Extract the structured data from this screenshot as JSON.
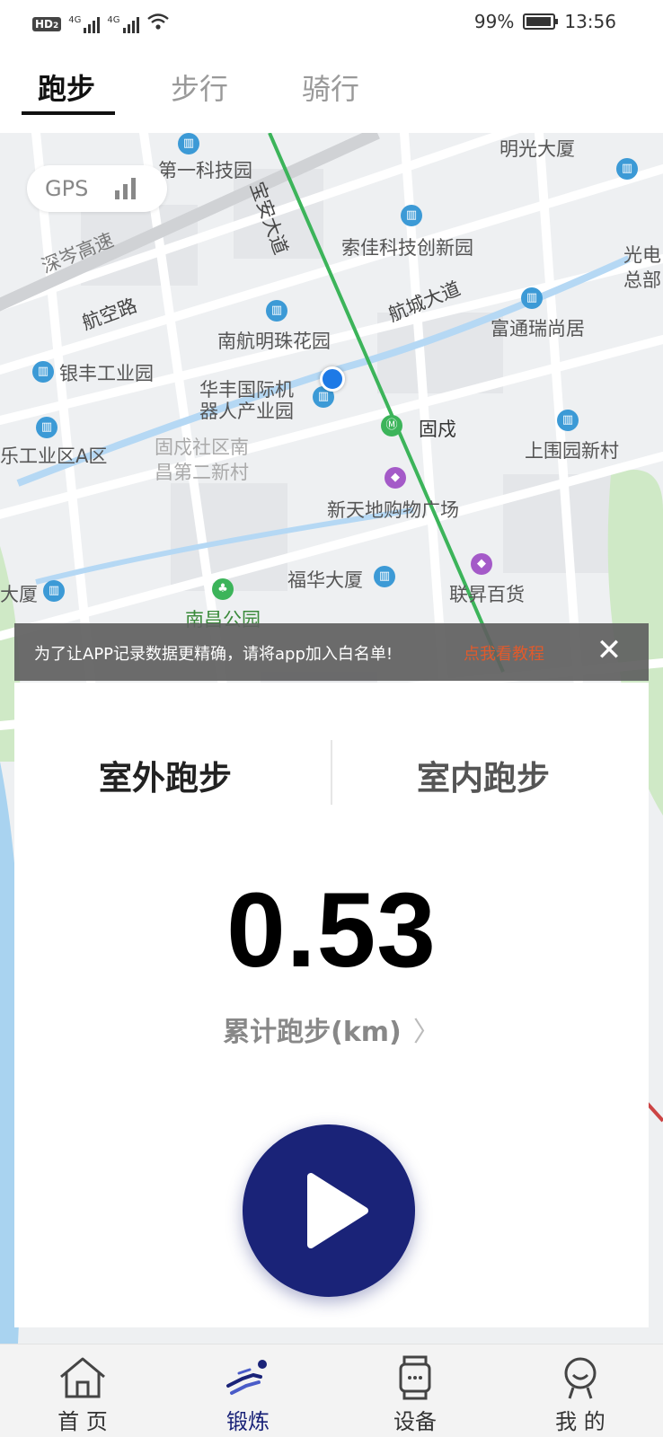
{
  "status_bar": {
    "network_left": "HD",
    "network_sub": "2",
    "signal_1": "4G",
    "signal_2": "4G",
    "battery": "99%",
    "time": "13:56"
  },
  "tabs": [
    {
      "label": "跑步",
      "active": true
    },
    {
      "label": "步行",
      "active": false
    },
    {
      "label": "骑行",
      "active": false
    }
  ],
  "map": {
    "gps_label": "GPS",
    "labels": [
      "第一科技园",
      "明光大厦",
      "宝安大道",
      "深岑高速",
      "索佳科技创新园",
      "光电",
      "总部",
      "航空路",
      "航城大道",
      "南航明珠花园",
      "富通瑞尚居",
      "银丰工业园",
      "华丰国际机",
      "器人产业园",
      "固戍",
      "乐工业区A区",
      "固戍社区南",
      "昌第二新村",
      "上围园新村",
      "新天地购物广场",
      "福华大厦",
      "联昇百货",
      "大厦",
      "南昌公园"
    ]
  },
  "notice": {
    "text": "为了让APP记录数据更精确，请将app加入白名单!",
    "link": "点我看教程"
  },
  "mode": {
    "outdoor": "室外跑步",
    "indoor": "室内跑步"
  },
  "distance": {
    "value": "0.53",
    "label": "累计跑步(km)"
  },
  "bottom_nav": [
    {
      "label": "首 页",
      "icon": "home-icon",
      "active": false
    },
    {
      "label": "锻炼",
      "icon": "runner-icon",
      "active": true
    },
    {
      "label": "设备",
      "icon": "watch-icon",
      "active": false
    },
    {
      "label": "我 的",
      "icon": "profile-icon",
      "active": false
    }
  ],
  "colors": {
    "accent": "#1a2378",
    "notice_link": "#e05a2c",
    "metro_line": "#3cb45a"
  }
}
